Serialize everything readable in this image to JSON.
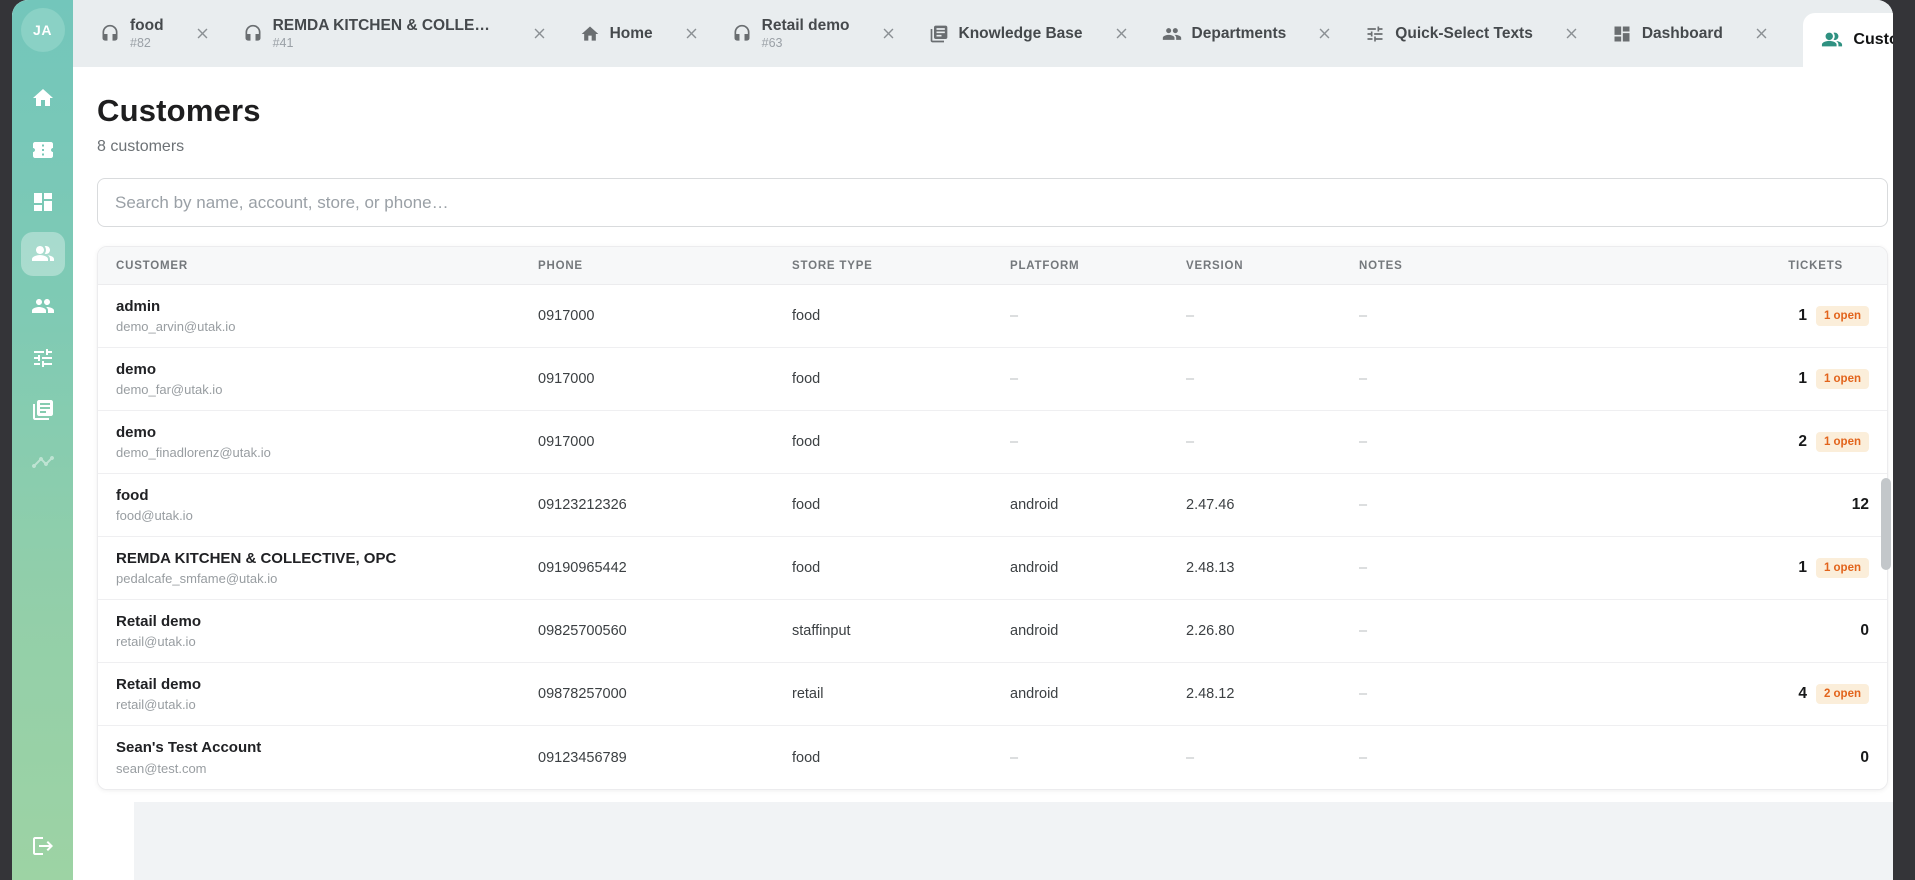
{
  "tabbar": {
    "tabs": [
      {
        "icon": "headset",
        "label": "food",
        "sublabel": "#82",
        "close": true,
        "name": "food"
      },
      {
        "icon": "headset",
        "label": "REMDA KITCHEN & COLLECTI…",
        "sublabel": "#41",
        "close": true,
        "name": "remda-kitchen"
      },
      {
        "icon": "home",
        "label": "Home",
        "sublabel": "",
        "close": true,
        "name": "home"
      },
      {
        "icon": "headset",
        "label": "Retail demo",
        "sublabel": "#63",
        "close": true,
        "name": "retail-demo"
      },
      {
        "icon": "library",
        "label": "Knowledge Base",
        "sublabel": "",
        "close": true,
        "name": "knowledge-base"
      },
      {
        "icon": "departments",
        "label": "Departments",
        "sublabel": "",
        "close": true,
        "name": "departments"
      },
      {
        "icon": "tune",
        "label": "Quick-Select Texts",
        "sublabel": "",
        "close": true,
        "name": "quick-select-texts"
      },
      {
        "icon": "dashboard",
        "label": "Dashboard",
        "sublabel": "",
        "close": true,
        "name": "dashboard"
      },
      {
        "icon": "customers",
        "label": "Customers",
        "sublabel": "",
        "close": false,
        "active": true,
        "name": "customers"
      }
    ]
  },
  "sidebar": {
    "avatar_initials": "JA",
    "items": [
      {
        "icon": "home",
        "name": "home"
      },
      {
        "icon": "ticket",
        "name": "tickets"
      },
      {
        "icon": "dashboard",
        "name": "dashboard"
      },
      {
        "icon": "customers",
        "name": "customers",
        "active": true
      },
      {
        "icon": "departments",
        "name": "departments"
      },
      {
        "icon": "tune",
        "name": "quick-select-texts"
      },
      {
        "icon": "library",
        "name": "knowledge-base"
      },
      {
        "icon": "analytics",
        "name": "analytics",
        "faded": true
      }
    ]
  },
  "page": {
    "title": "Customers",
    "subtitle": "8 customers",
    "search_placeholder": "Search by name, account, store, or phone…"
  },
  "table": {
    "columns": [
      "Customer",
      "Phone",
      "Store Type",
      "Platform",
      "Version",
      "Notes",
      "Tickets"
    ],
    "rows": [
      {
        "name": "admin",
        "email": "demo_arvin@utak.io",
        "phone": "0917000",
        "store_type": "food",
        "platform": "–",
        "version": "–",
        "notes": "–",
        "tickets": "1",
        "open_badge": "1 open"
      },
      {
        "name": "demo",
        "email": "demo_far@utak.io",
        "phone": "0917000",
        "store_type": "food",
        "platform": "–",
        "version": "–",
        "notes": "–",
        "tickets": "1",
        "open_badge": "1 open"
      },
      {
        "name": "demo",
        "email": "demo_finadlorenz@utak.io",
        "phone": "0917000",
        "store_type": "food",
        "platform": "–",
        "version": "–",
        "notes": "–",
        "tickets": "2",
        "open_badge": "1 open"
      },
      {
        "name": "food",
        "email": "food@utak.io",
        "phone": "09123212326",
        "store_type": "food",
        "platform": "android",
        "version": "2.47.46",
        "notes": "–",
        "tickets": "12",
        "open_badge": ""
      },
      {
        "name": "REMDA KITCHEN & COLLECTIVE, OPC",
        "email": "pedalcafe_smfame@utak.io",
        "phone": "09190965442",
        "store_type": "food",
        "platform": "android",
        "version": "2.48.13",
        "notes": "–",
        "tickets": "1",
        "open_badge": "1 open"
      },
      {
        "name": "Retail demo",
        "email": "retail@utak.io",
        "phone": "09825700560",
        "store_type": "staffinput",
        "platform": "android",
        "version": "2.26.80",
        "notes": "–",
        "tickets": "0",
        "open_badge": ""
      },
      {
        "name": "Retail demo",
        "email": "retail@utak.io",
        "phone": "09878257000",
        "store_type": "retail",
        "platform": "android",
        "version": "2.48.12",
        "notes": "–",
        "tickets": "4",
        "open_badge": "2 open"
      },
      {
        "name": "Sean's Test Account",
        "email": "sean@test.com",
        "phone": "09123456789",
        "store_type": "food",
        "platform": "–",
        "version": "–",
        "notes": "–",
        "tickets": "0",
        "open_badge": ""
      }
    ]
  },
  "colors": {
    "accent_teal": "#73c6bb",
    "badge_bg": "#fbeeda",
    "badge_text": "#e2641c"
  }
}
